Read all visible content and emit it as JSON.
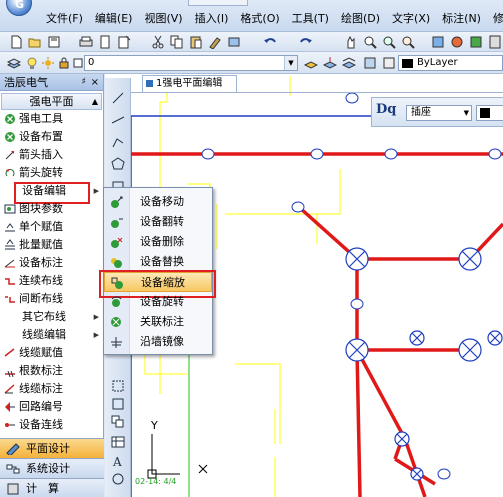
{
  "menu": {
    "items": [
      "文件(F)",
      "编辑(E)",
      "视图(V)",
      "插入(I)",
      "格式(O)",
      "工具(T)",
      "绘图(D)",
      "文字(X)",
      "标注(N)",
      "修改"
    ]
  },
  "toolbar": {
    "layer_value": "0",
    "linetype_value": "ByLayer"
  },
  "left_panel": {
    "title": "浩辰电气",
    "pin": "♯",
    "close": "×",
    "section": "强电平面",
    "items": [
      {
        "label": "强电工具",
        "icon": "green-x-icon"
      },
      {
        "label": "设备布置",
        "icon": "green-x-icon"
      },
      {
        "label": "箭头插入",
        "icon": "arrow-insert-icon"
      },
      {
        "label": "箭头旋转",
        "icon": "arrow-rotate-icon"
      },
      {
        "label": "设备编辑",
        "icon": "",
        "highlighted": true,
        "submenu": true
      },
      {
        "label": "图块参数",
        "icon": "block-param-icon"
      },
      {
        "label": "单个赋值",
        "icon": "assign-icon"
      },
      {
        "label": "批量赋值",
        "icon": "batch-assign-icon"
      },
      {
        "label": "设备标注",
        "icon": "device-mark-icon"
      },
      {
        "label": "连续布线",
        "icon": "wire-icon"
      },
      {
        "label": "间断布线",
        "icon": "break-wire-icon"
      },
      {
        "label": "其它布线",
        "icon": "",
        "submenu": true
      },
      {
        "label": "线缆编辑",
        "icon": "",
        "submenu": true
      },
      {
        "label": "线缆赋值",
        "icon": "wire-assign-icon"
      },
      {
        "label": "根数标注",
        "icon": "count-mark-icon"
      },
      {
        "label": "线缆标注",
        "icon": "wire-mark-icon"
      },
      {
        "label": "回路编号",
        "icon": "loop-number-icon"
      },
      {
        "label": "设备连线",
        "icon": "connect-icon"
      }
    ],
    "bottom_tabs": [
      {
        "label": "平面设计",
        "active": true
      },
      {
        "label": "系统设计",
        "active": false
      },
      {
        "label": "计　算",
        "active": false
      }
    ]
  },
  "document": {
    "tab_label": "1强电平面编辑"
  },
  "float_bar": {
    "label": "Dq",
    "combo_value": "插座"
  },
  "context_menu": {
    "items": [
      {
        "label": "设备移动",
        "active": false
      },
      {
        "label": "设备翻转",
        "active": false
      },
      {
        "label": "设备删除",
        "active": false
      },
      {
        "label": "设备替换",
        "active": false
      },
      {
        "label": "设备缩放",
        "active": true
      },
      {
        "label": "设备旋转",
        "active": false
      },
      {
        "label": "关联标注",
        "active": false
      },
      {
        "label": "沿墙镜像",
        "active": false
      }
    ]
  },
  "drawing": {
    "axis_y_label": "Y",
    "axis_x_label": "X",
    "axis_note": "02-14: 4/4"
  },
  "colors": {
    "wire": "#e01818",
    "wall": "#ffff00",
    "grid_line": "#1f3fbf",
    "highlight": "#e02020"
  }
}
